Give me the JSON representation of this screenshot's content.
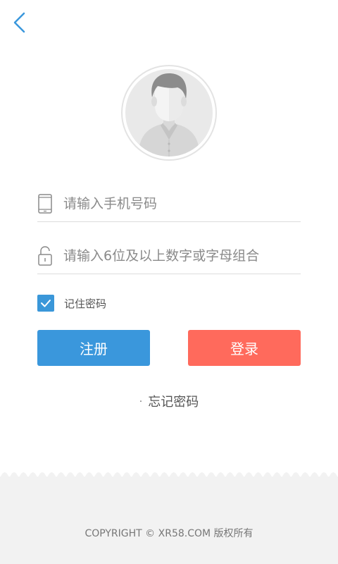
{
  "nav": {
    "back_icon": "chevron-left-icon",
    "accent_color": "#3a97dc"
  },
  "avatar": {
    "icon": "default-user-avatar-icon"
  },
  "phone_field": {
    "icon": "mobile-phone-icon",
    "placeholder": "请输入手机号码",
    "value": ""
  },
  "password_field": {
    "icon": "unlock-icon",
    "placeholder": "请输入6位及以上数字或字母组合",
    "value": ""
  },
  "remember": {
    "label": "记住密码",
    "checked": true
  },
  "buttons": {
    "register_label": "注册",
    "register_color": "#3a97dc",
    "login_label": "登录",
    "login_color": "#ff6a5c"
  },
  "forgot": {
    "dot": "·",
    "label": "忘记密码"
  },
  "footer": {
    "copyright": "COPYRIGHT © XR58.COM 版权所有",
    "background": "#f2f2f2"
  }
}
